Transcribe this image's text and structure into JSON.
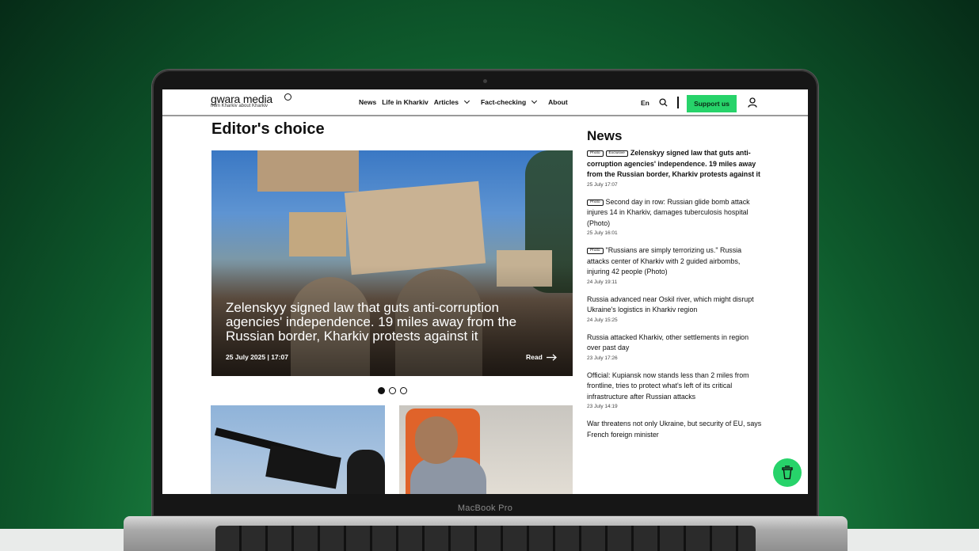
{
  "device": {
    "model_label": "MacBook Pro"
  },
  "header": {
    "logo_text": "gwara media",
    "logo_sub": "from Kharkiv about Kharkiv",
    "nav": [
      "News",
      "Life in Kharkiv",
      "Articles",
      "Fact-checking",
      "About"
    ],
    "lang": "En",
    "support_label": "Support us"
  },
  "editors_choice": {
    "title": "Editor's choice",
    "hero": {
      "headline": "Zelenskyy signed law that guts anti-corruption agencies' independence. 19 miles away from the Russian border, Kharkiv protests against it",
      "date": "25 July 2025 | 17:07",
      "read_label": "Read"
    }
  },
  "news": {
    "title": "News",
    "items": [
      {
        "tags": [
          "Photo",
          "Exclusive"
        ],
        "headline": "Zelenskyy signed law that guts anti-corruption agencies' independence. 19 miles away from the Russian border, Kharkiv protests against it",
        "date": "25 July 17:07",
        "bold": true
      },
      {
        "tags": [
          "Photo"
        ],
        "headline": "Second day in row: Russian glide bomb attack injures 14 in Kharkiv, damages tuberculosis hospital (Photo)",
        "date": "25 July 16:01",
        "bold": false
      },
      {
        "tags": [
          "Photo"
        ],
        "headline": "\"Russians are simply terrorizing us.\" Russia attacks center of Kharkiv with 2 guided airbombs, injuring 42 people (Photo)",
        "date": "24 July 19:11",
        "bold": false
      },
      {
        "tags": [],
        "headline": "Russia advanced near Oskil river, which might disrupt Ukraine's logistics in Kharkiv region",
        "date": "24 July 15:25",
        "bold": false
      },
      {
        "tags": [],
        "headline": "Russia attacked Kharkiv, other settlements in region over past day",
        "date": "23 July 17:26",
        "bold": false
      },
      {
        "tags": [],
        "headline": "Official: Kupiansk now stands less than 2 miles from frontline, tries to protect what's left of its critical infrastructure after Russian attacks",
        "date": "23 July 14:19",
        "bold": false
      },
      {
        "tags": [],
        "headline": "War threatens not only Ukraine, but security of EU, says French foreign minister",
        "date": "",
        "bold": false
      }
    ]
  },
  "colors": {
    "accent": "#27d36a"
  }
}
